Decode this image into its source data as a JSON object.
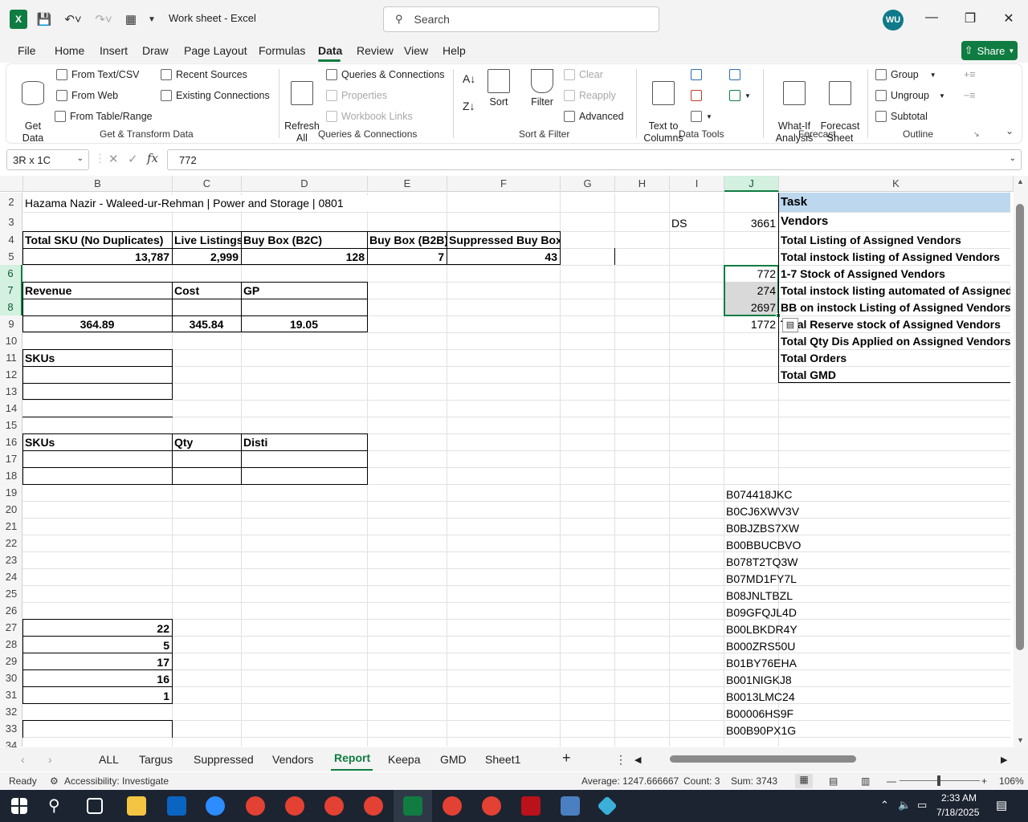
{
  "titlebar": {
    "doc_title": "Work sheet  -  Excel",
    "search_placeholder": "Search",
    "user_initials": "WU"
  },
  "menu": [
    "File",
    "Home",
    "Insert",
    "Draw",
    "Page Layout",
    "Formulas",
    "Data",
    "Review",
    "View",
    "Help"
  ],
  "share_label": "Share",
  "ribbon": {
    "get_data": "Get\nData",
    "from_text_csv": "From Text/CSV",
    "from_web": "From Web",
    "from_table_range": "From Table/Range",
    "recent_sources": "Recent Sources",
    "existing_connections": "Existing Connections",
    "group_get_transform": "Get & Transform Data",
    "refresh_all": "Refresh\nAll",
    "queries_connections": "Queries & Connections",
    "properties": "Properties",
    "workbook_links": "Workbook Links",
    "group_queries": "Queries & Connections",
    "sort": "Sort",
    "filter": "Filter",
    "clear": "Clear",
    "reapply": "Reapply",
    "advanced": "Advanced",
    "group_sort_filter": "Sort & Filter",
    "text_to_columns": "Text to\nColumns",
    "group_data_tools": "Data Tools",
    "what_if": "What-If\nAnalysis",
    "forecast_sheet": "Forecast\nSheet",
    "group_forecast": "Forecast",
    "group": "Group",
    "ungroup": "Ungroup",
    "subtotal": "Subtotal",
    "group_outline": "Outline"
  },
  "formula_bar": {
    "name_box": "3R x 1C",
    "value": "772"
  },
  "columns": [
    "B",
    "C",
    "D",
    "E",
    "F",
    "G",
    "H",
    "I",
    "J",
    "K"
  ],
  "rows": [
    "2",
    "3",
    "4",
    "5",
    "6",
    "7",
    "8",
    "9",
    "10",
    "11",
    "12",
    "13",
    "14",
    "15",
    "16",
    "17",
    "18",
    "19",
    "20",
    "21",
    "22",
    "23",
    "24",
    "25",
    "26",
    "27",
    "28",
    "29",
    "30",
    "31",
    "32",
    "33",
    "34"
  ],
  "cells": {
    "b2": "Hazama Nazir - Waleed-ur-Rehman | Power and Storage | 0801",
    "b4": "Total SKU (No Duplicates)",
    "c4": "Live Listings",
    "d4": "Buy Box (B2C)",
    "e4": "Buy Box (B2B)",
    "f4": "Suppressed Buy Box",
    "b5": "13,787",
    "c5": "2,999",
    "d5": "128",
    "e5": "7",
    "f5": "43",
    "b7": "Revenue",
    "c7": "Cost",
    "d7": "GP",
    "b9": "364.89",
    "c9": "345.84",
    "d9": "19.05",
    "b11": "SKUs",
    "b16": "SKUs",
    "c16": "Qty",
    "d16": "Disti",
    "b27": "22",
    "b28": "5",
    "b29": "17",
    "b30": "16",
    "b31": "1",
    "i3": "DS",
    "j3": "3661",
    "j6": "772",
    "j7": "274",
    "j8": "2697",
    "j9": "1772",
    "k2": "Task",
    "k3": "Vendors",
    "k4": "Total Listing of Assigned Vendors",
    "k5": "Total instock listing of Assigned Vendors",
    "k6": "1-7 Stock of Assigned Vendors",
    "k7": "Total instock listing automated of Assigned",
    "k8": "BB on instock Listing of Assigned Vendors",
    "k9": "Total Reserve stock of Assigned Vendors",
    "k10": "Total Qty Dis Applied on Assigned Vendors",
    "k11": "Total Orders",
    "k12": "Total GMD"
  },
  "asins": [
    "B074418JKC",
    "B0CJ6XWV3V",
    "B0BJZBS7XW",
    "B00BBUCBVO",
    "B078T2TQ3W",
    "B07MD1FY7L",
    "B08JNLTBZL",
    "B09GFQJL4D",
    "B00LBKDR4Y",
    "B000ZRS50U",
    "B01BY76EHA",
    "B001NIGKJ8",
    "B0013LMC24",
    "B00006HS9F",
    "B00B90PX1G"
  ],
  "sheet_tabs": [
    "ALL",
    "Targus",
    "Suppressed",
    "Vendors",
    "Report",
    "Keepa",
    "GMD",
    "Sheet1"
  ],
  "active_tab": "Report",
  "status": {
    "ready": "Ready",
    "accessibility": "Accessibility: Investigate",
    "average": "Average: 1247.666667",
    "count": "Count: 3",
    "sum": "Sum: 3743",
    "zoom": "106%"
  },
  "taskbar": {
    "time": "2:33 AM",
    "date": "7/18/2025"
  },
  "colors": {
    "accent": "#107c41",
    "selection": "#d3f0e0",
    "task_header_bg": "#bdd7ee",
    "taskbar_bg": "#1c2431"
  }
}
